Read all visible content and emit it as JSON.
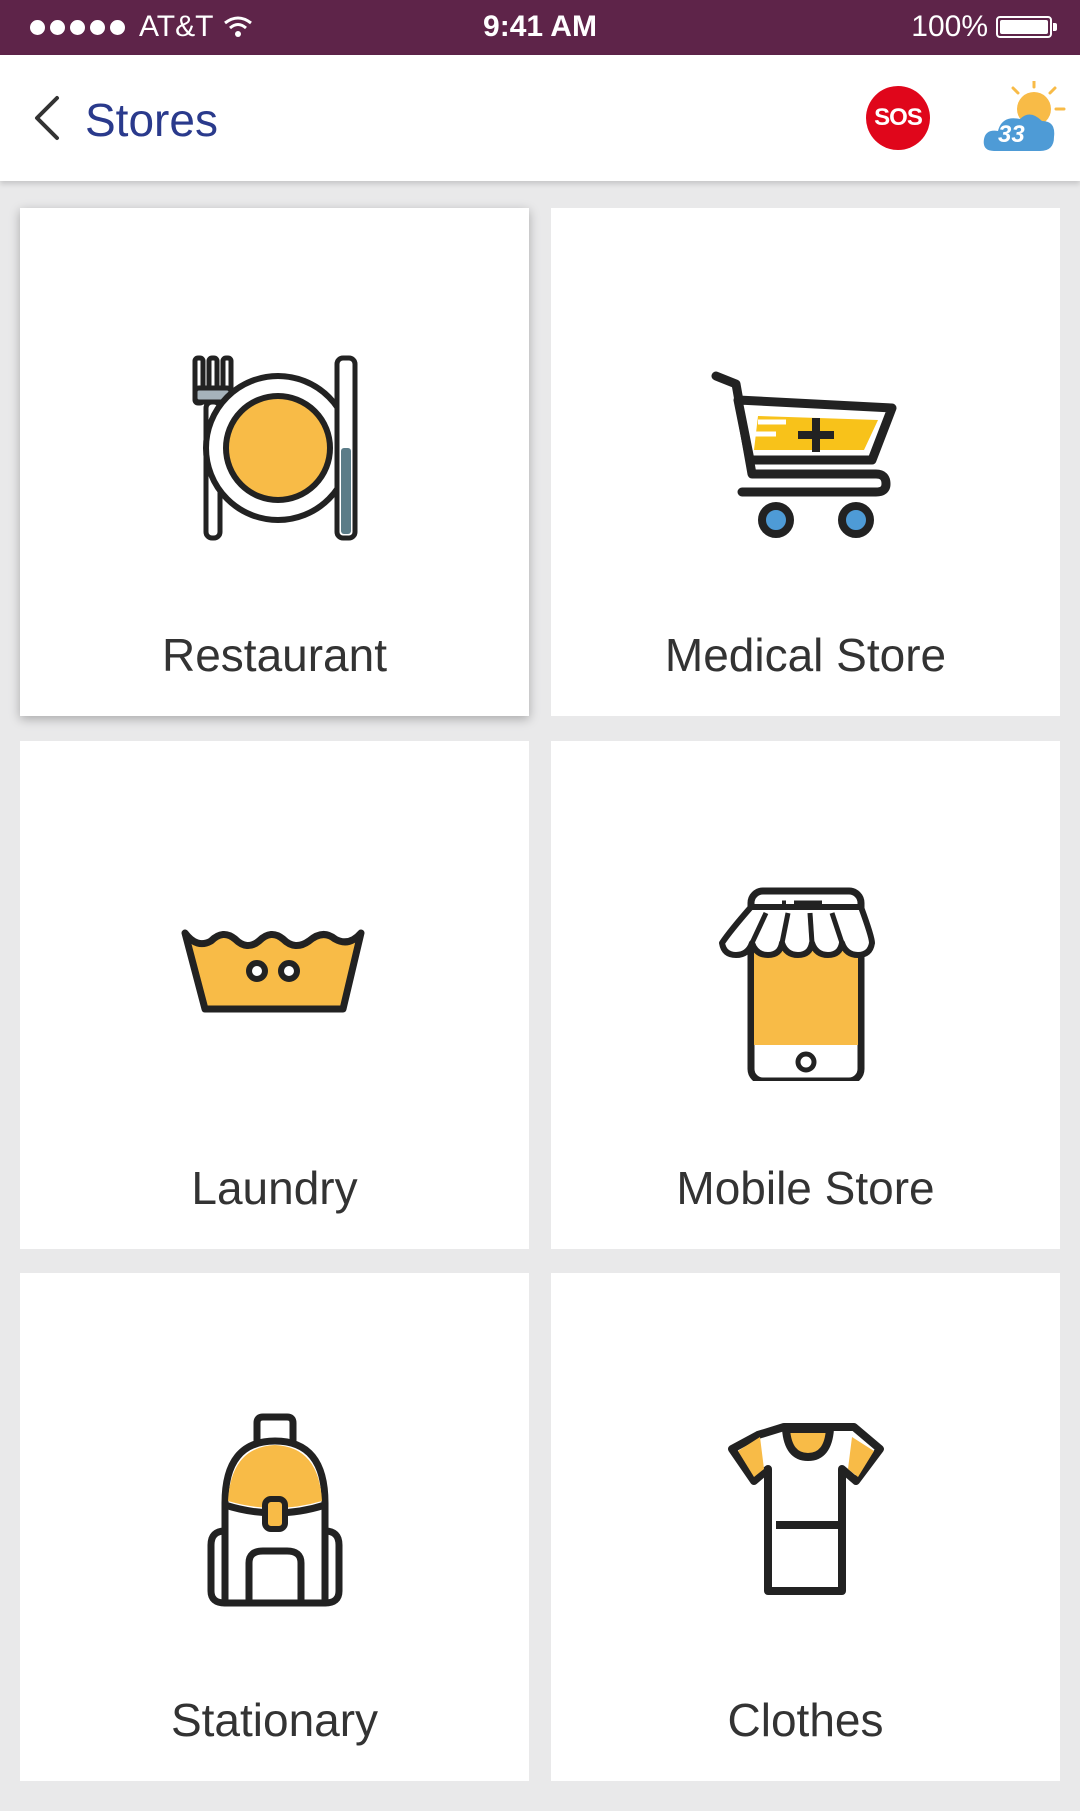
{
  "status_bar": {
    "carrier": "AT&T",
    "time": "9:41 AM",
    "battery": "100%"
  },
  "header": {
    "title": "Stores",
    "sos_label": "SOS",
    "weather_temp": "33"
  },
  "stores": [
    {
      "label": "Restaurant",
      "icon": "restaurant-icon"
    },
    {
      "label": "Medical Store",
      "icon": "medical-cart-icon"
    },
    {
      "label": "Laundry",
      "icon": "laundry-icon"
    },
    {
      "label": "Mobile Store",
      "icon": "mobile-store-icon"
    },
    {
      "label": "Stationary",
      "icon": "backpack-icon"
    },
    {
      "label": "Clothes",
      "icon": "tshirt-icon"
    }
  ],
  "colors": {
    "status_bar": "#5e2449",
    "title": "#2a3a8c",
    "sos": "#e0061b",
    "icon_fill": "#f8bb47",
    "icon_stroke": "#222222"
  }
}
